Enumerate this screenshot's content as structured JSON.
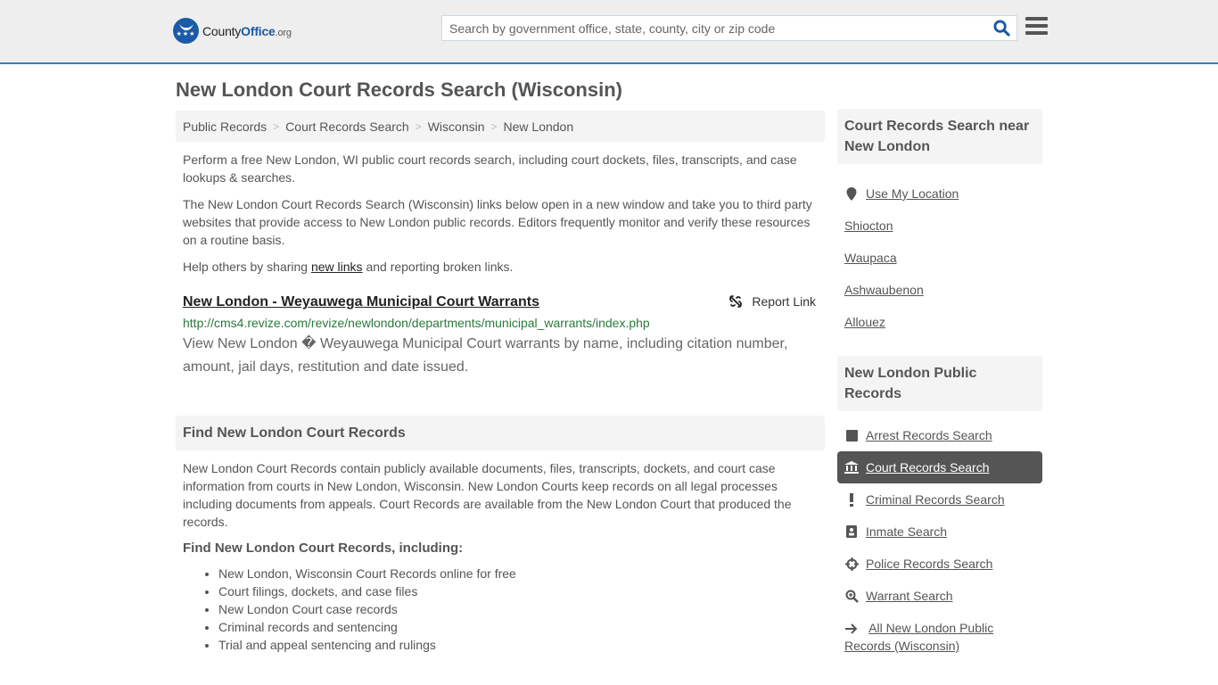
{
  "header": {
    "logo": {
      "brand_a": "County",
      "brand_b": "Office",
      "brand_c": ".org"
    },
    "search": {
      "placeholder": "Search by government office, state, county, city or zip code",
      "value": ""
    },
    "icons": {
      "search": "search-icon",
      "menu": "hamburger-menu-icon"
    }
  },
  "main": {
    "title": "New London Court Records Search (Wisconsin)",
    "breadcrumb": [
      "Public Records",
      "Court Records Search",
      "Wisconsin",
      "New London"
    ],
    "intro": [
      "Perform a free New London, WI public court records search, including court dockets, files, transcripts, and case lookups & searches.",
      "The New London Court Records Search (Wisconsin) links below open in a new window and take you to third party websites that provide access to New London public records. Editors frequently monitor and verify these resources on a routine basis."
    ],
    "share": {
      "before": "Help others by sharing ",
      "link": "new links",
      "after": " and reporting broken links."
    },
    "result": {
      "title": "New London - Weyauwega Municipal Court Warrants",
      "url": "http://cms4.revize.com/revize/newlondon/departments/municipal_warrants/index.php",
      "description": "View New London � Weyauwega Municipal Court warrants by name, including citation number, amount, jail days, restitution and date issued.",
      "report_label": "Report Link"
    },
    "find_section": {
      "heading": "Find New London Court Records",
      "body": "New London Court Records contain publicly available documents, files, transcripts, dockets, and court case information from courts in New London, Wisconsin. New London Courts keep records on all legal processes including documents from appeals. Court Records are available from the New London Court that produced the records.",
      "subheading": "Find New London Court Records, including:",
      "items": [
        "New London, Wisconsin Court Records online for free",
        "Court filings, dockets, and case files",
        "New London Court case records",
        "Criminal records and sentencing",
        "Trial and appeal sentencing and rulings"
      ]
    }
  },
  "sidebar": {
    "nearby": {
      "heading": "Court Records Search near New London",
      "use_location": "Use My Location",
      "places": [
        "Shiocton",
        "Waupaca",
        "Ashwaubenon",
        "Allouez"
      ]
    },
    "public_records": {
      "heading": "New London Public Records",
      "items": [
        {
          "label": "Arrest Records Search",
          "icon": "square-icon",
          "active": false
        },
        {
          "label": "Court Records Search",
          "icon": "courthouse-icon",
          "active": true
        },
        {
          "label": "Criminal Records Search",
          "icon": "exclamation-icon",
          "active": false
        },
        {
          "label": "Inmate Search",
          "icon": "id-badge-icon",
          "active": false
        },
        {
          "label": "Police Records Search",
          "icon": "crosshairs-icon",
          "active": false
        },
        {
          "label": "Warrant Search",
          "icon": "search-plus-icon",
          "active": false
        }
      ],
      "all_link": "All New London Public Records (Wisconsin)"
    }
  },
  "colors": {
    "accent": "#3d7fb3",
    "brand": "#1a5aa6",
    "url_green": "#2a7a3a",
    "active_bg": "#555555"
  }
}
